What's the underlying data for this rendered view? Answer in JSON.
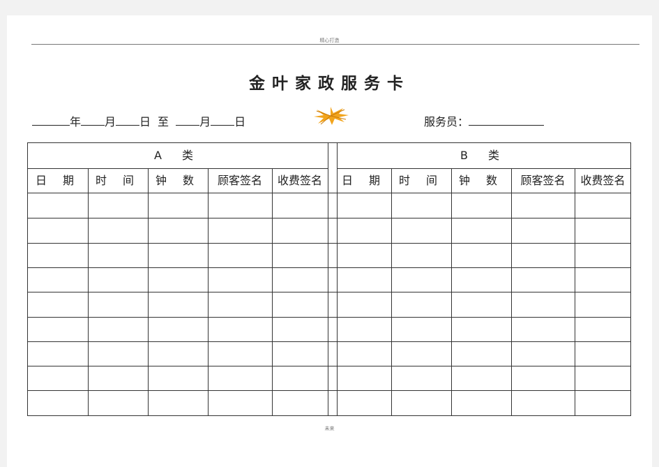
{
  "header": {
    "text": "精心打造"
  },
  "title": "金叶家政服务卡",
  "info": {
    "year": "年",
    "month": "月",
    "day": "日",
    "to": "至",
    "month2": "月",
    "day2": "日",
    "server_label": "服务员："
  },
  "table": {
    "section_a": "A  类",
    "section_b": "B  类",
    "columns": [
      "日 期",
      "时 间",
      "钟 数",
      "顾客签名",
      "收费签名"
    ],
    "rows": [
      [
        "",
        "",
        "",
        "",
        "",
        "",
        "",
        "",
        "",
        ""
      ],
      [
        "",
        "",
        "",
        "",
        "",
        "",
        "",
        "",
        "",
        ""
      ],
      [
        "",
        "",
        "",
        "",
        "",
        "",
        "",
        "",
        "",
        ""
      ],
      [
        "",
        "",
        "",
        "",
        "",
        "",
        "",
        "",
        "",
        ""
      ],
      [
        "",
        "",
        "",
        "",
        "",
        "",
        "",
        "",
        "",
        ""
      ],
      [
        "",
        "",
        "",
        "",
        "",
        "",
        "",
        "",
        "",
        ""
      ],
      [
        "",
        "",
        "",
        "",
        "",
        "",
        "",
        "",
        "",
        ""
      ],
      [
        "",
        "",
        "",
        "",
        "",
        "",
        "",
        "",
        "",
        ""
      ],
      [
        "",
        "",
        "",
        "",
        "",
        "",
        "",
        "",
        "",
        ""
      ]
    ]
  },
  "footer": {
    "text": "未来"
  },
  "colors": {
    "leaf": "#f2a41c",
    "leaf_vein": "#c97a0a"
  }
}
